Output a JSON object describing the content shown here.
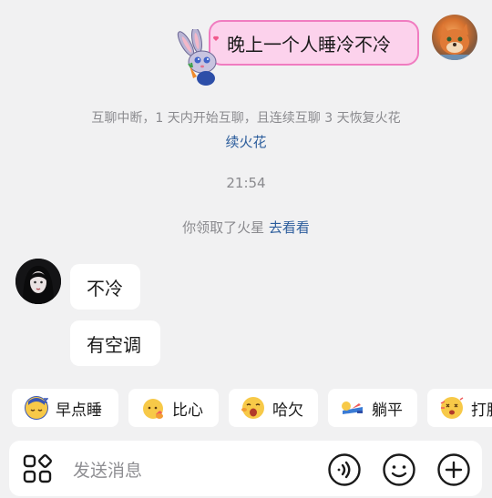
{
  "messages": {
    "sent_1": "晚上一个人睡冷不冷",
    "system_notice": "互聊中断，1 天内开始互聊，且连续互聊 3 天恢复火花",
    "system_link": "续火花",
    "time": "21:54",
    "spark_text": "你领取了火星",
    "spark_link": "去看看",
    "received_1": "不冷",
    "received_2": "有空调"
  },
  "quick_reactions": [
    {
      "label": "早点睡",
      "icon": "sleep-moon-emoji"
    },
    {
      "label": "比心",
      "icon": "heart-hand-emoji"
    },
    {
      "label": "哈欠",
      "icon": "yawn-emoji"
    },
    {
      "label": "躺平",
      "icon": "lie-flat-emoji"
    },
    {
      "label": "打脸",
      "icon": "face-slap-emoji"
    }
  ],
  "input": {
    "placeholder": "发送消息"
  },
  "colors": {
    "background": "#f1f1f2",
    "sent_bubble": "#fcd2ec",
    "sent_border": "#f07cc0",
    "link": "#2c5d9c"
  }
}
